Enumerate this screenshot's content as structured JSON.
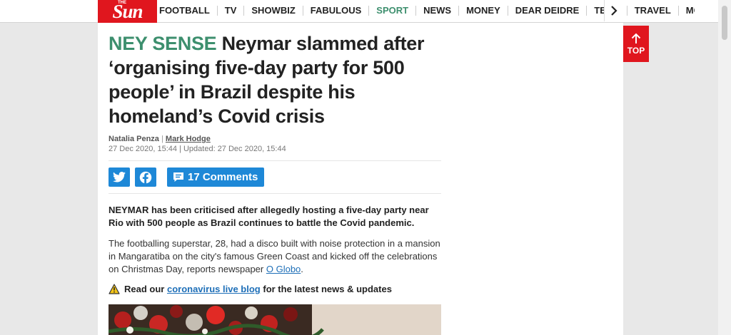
{
  "brand": {
    "the": "THE",
    "name": "Sun"
  },
  "nav": {
    "items": [
      "FOOTBALL",
      "TV",
      "SHOWBIZ",
      "FABULOUS",
      "SPORT",
      "NEWS",
      "MONEY",
      "DEAR DEIDRE",
      "TECH",
      "TRAVEL",
      "MC"
    ]
  },
  "top_button": {
    "label": "TOP"
  },
  "article": {
    "kicker": "NEY SENSE",
    "title": "Neymar slammed after ‘organising five-day party for 500 people’ in Brazil despite his homeland’s Covid crisis",
    "author1": "Natalia Penza",
    "author_sep": "|",
    "author2": "Mark Hodge",
    "dates": "27 Dec 2020, 15:44 | Updated: 27 Dec 2020, 15:44",
    "comments_label": "17 Comments",
    "lead": "NEYMAR has been criticised after allegedly hosting a five-day party near Rio with 500 people as Brazil continues to battle the Covid pandemic.",
    "para_text": "The footballing superstar, 28, had a disco built with noise protection in a mansion in Mangaratiba on the city's famous Green Coast and kicked off the celebrations on Christmas Day, reports newspaper",
    "para_link": "O Globo",
    "para_end": ".",
    "blog_prefix": "Read our",
    "blog_link": "coronavirus live blog",
    "blog_suffix": "for the latest news & updates"
  },
  "colors": {
    "brand_red": "#e0161e",
    "kicker_green": "#3d8f6e",
    "social_blue": "#1e88d7",
    "link_blue": "#1e6fb8"
  },
  "icons": [
    "twitter-icon",
    "facebook-icon",
    "comment-icon",
    "warning-icon",
    "chevron-right-icon",
    "arrow-up-icon"
  ]
}
